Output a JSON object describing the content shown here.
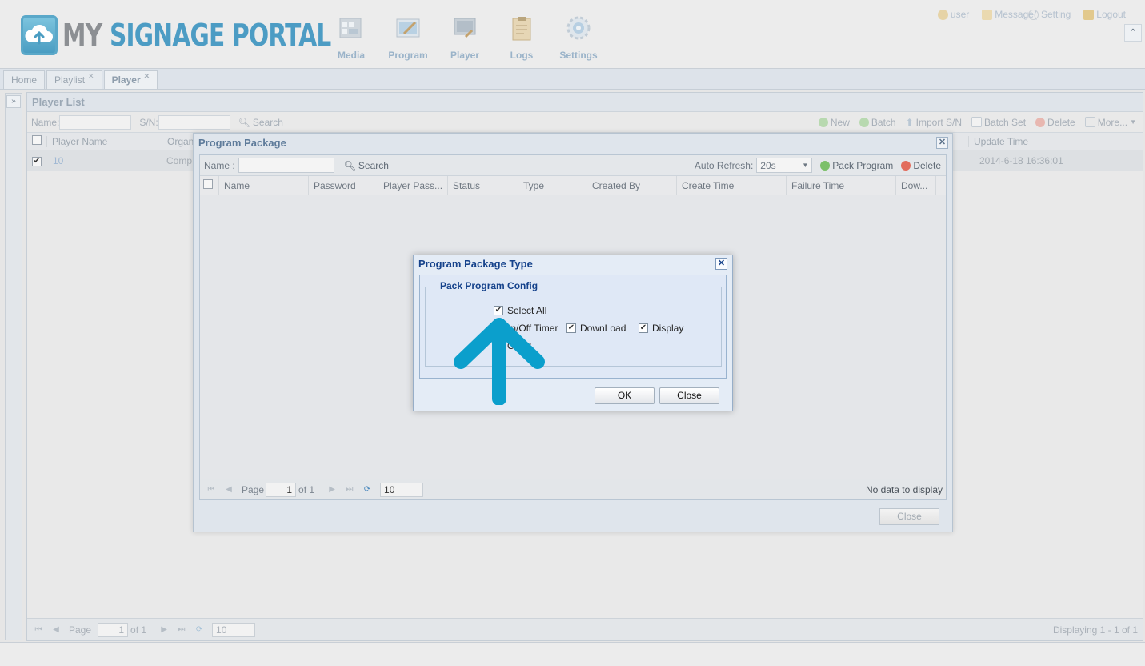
{
  "brand": {
    "word1": "MY ",
    "word2": "SIGNAGE PORTAL"
  },
  "nav": [
    {
      "label": "Media",
      "icon": "film-icon"
    },
    {
      "label": "Program",
      "icon": "program-icon"
    },
    {
      "label": "Player",
      "icon": "player-icon"
    },
    {
      "label": "Logs",
      "icon": "clipboard-icon"
    },
    {
      "label": "Settings",
      "icon": "gear-icon"
    }
  ],
  "userbar": {
    "user": "user",
    "message": "Message(",
    "setting": "Setting",
    "logout": "Logout"
  },
  "tabs": [
    {
      "label": "Home",
      "closable": false
    },
    {
      "label": "Playlist",
      "closable": true
    },
    {
      "label": "Player",
      "closable": true,
      "active": true
    }
  ],
  "player_list": {
    "title": "Player List",
    "filters": {
      "name_label": "Name:",
      "sn_label": "S/N:",
      "search": "Search"
    },
    "actions": {
      "new": "New",
      "batch": "Batch",
      "import": "Import S/N",
      "batch_set": "Batch Set",
      "delete": "Delete",
      "more": "More..."
    },
    "columns": {
      "player_name": "Player Name",
      "organ": "Organ",
      "update_time": "Update Time"
    },
    "row": {
      "name": "10",
      "organ": "Comp",
      "update_time": "2014-6-18 16:36:01"
    },
    "pager": {
      "page_label": "Page",
      "page": "1",
      "of": "of 1",
      "page_size": "10",
      "status": "Displaying 1 - 1 of 1"
    }
  },
  "program_package": {
    "title": "Program Package",
    "name_label": "Name :",
    "search": "Search",
    "auto_refresh_label": "Auto Refresh:",
    "auto_refresh_value": "20s",
    "pack_program": "Pack Program",
    "delete": "Delete",
    "columns": [
      "Name",
      "Password",
      "Player Pass...",
      "Status",
      "Type",
      "Created By",
      "Create Time",
      "Failure Time",
      "Dow..."
    ],
    "pager": {
      "page_label": "Page",
      "page": "1",
      "of": "of 1",
      "page_size": "10",
      "status": "No data to display"
    },
    "close": "Close"
  },
  "package_type_dialog": {
    "title": "Program Package Type",
    "legend": "Pack Program Config",
    "options": {
      "select_all": {
        "label": "Select All",
        "checked": true
      },
      "onoff_timer": {
        "label": "On/Off Timer",
        "checked": true
      },
      "download": {
        "label": "DownLoad",
        "checked": true
      },
      "display": {
        "label": "Display",
        "checked": true
      },
      "other": {
        "label": "Other",
        "checked": true
      }
    },
    "ok": "OK",
    "close": "Close"
  },
  "colors": {
    "accent_blue": "#0b9fcc",
    "title_blue": "#15428b",
    "brand_blue": "#4c9cc4"
  }
}
